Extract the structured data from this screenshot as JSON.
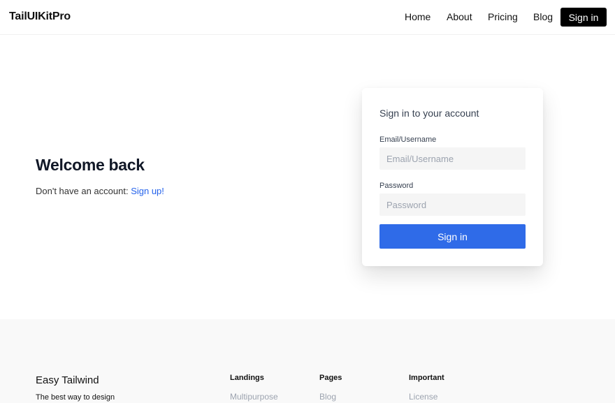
{
  "navbar": {
    "brand": "TailUIKitPro",
    "links": [
      "Home",
      "About",
      "Pricing",
      "Blog"
    ],
    "signin_label": "Sign in"
  },
  "hero": {
    "title": "Welcome back",
    "subtitle_prefix": "Don't have an account: ",
    "signup_link": "Sign up!"
  },
  "login_card": {
    "title": "Sign in to your account",
    "email_label": "Email/Username",
    "email_placeholder": "Email/Username",
    "email_value": "",
    "password_label": "Password",
    "password_placeholder": "Password",
    "password_value": "",
    "submit_label": "Sign in",
    "accent_color": "#2f6be8"
  },
  "footer": {
    "brand": "Easy Tailwind",
    "tagline": "The best way to design",
    "columns": [
      {
        "heading": "Landings",
        "first_link": "Multipurpose"
      },
      {
        "heading": "Pages",
        "first_link": "Blog"
      },
      {
        "heading": "Important",
        "first_link": "License"
      }
    ]
  }
}
